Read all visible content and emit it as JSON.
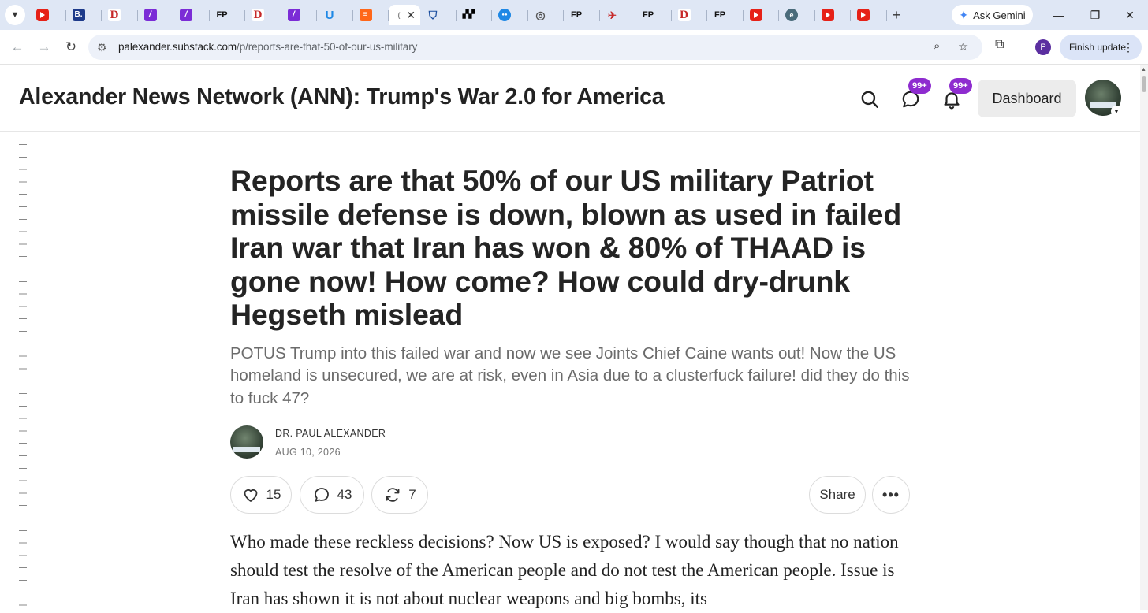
{
  "browser": {
    "tabs": [
      {
        "icon": "youtube-icon",
        "kind": "yt",
        "glyph": ""
      },
      {
        "icon": "b-favicon",
        "kind": "b",
        "glyph": "B."
      },
      {
        "icon": "d-favicon",
        "kind": "d",
        "glyph": "D"
      },
      {
        "icon": "substack-favicon",
        "kind": "s",
        "glyph": "/"
      },
      {
        "icon": "substack-favicon",
        "kind": "s",
        "glyph": "/"
      },
      {
        "icon": "fp-favicon",
        "kind": "fp",
        "glyph": "FP"
      },
      {
        "icon": "d-favicon",
        "kind": "d",
        "glyph": "D"
      },
      {
        "icon": "substack-favicon",
        "kind": "s",
        "glyph": "/"
      },
      {
        "icon": "t-favicon",
        "kind": "t",
        "glyph": "U"
      },
      {
        "icon": "bookmark-favicon",
        "kind": "ss",
        "glyph": "≡"
      },
      {
        "icon": "substack-favicon",
        "kind": "active",
        "glyph": ""
      },
      {
        "icon": "shield-favicon",
        "kind": "sh",
        "glyph": "⛉"
      },
      {
        "icon": "bird-favicon",
        "kind": "bl",
        "glyph": "▞▞"
      },
      {
        "icon": "circle-favicon",
        "kind": "cd",
        "glyph": "●●"
      },
      {
        "icon": "globe-icon",
        "kind": "gl",
        "glyph": "◎"
      },
      {
        "icon": "fp-favicon",
        "kind": "fp",
        "glyph": "FP"
      },
      {
        "icon": "plane-favicon",
        "kind": "pl",
        "glyph": "✈"
      },
      {
        "icon": "fp-favicon",
        "kind": "fp",
        "glyph": "FP"
      },
      {
        "icon": "d-favicon",
        "kind": "d",
        "glyph": "D"
      },
      {
        "icon": "fp-favicon",
        "kind": "fp",
        "glyph": "FP"
      },
      {
        "icon": "youtube-icon",
        "kind": "yt",
        "glyph": ""
      },
      {
        "icon": "epoch-favicon",
        "kind": "en",
        "glyph": "e"
      },
      {
        "icon": "youtube-icon",
        "kind": "yt",
        "glyph": ""
      },
      {
        "icon": "youtube-icon",
        "kind": "yt",
        "glyph": ""
      }
    ],
    "gemini_label": "Ask Gemini",
    "url_host": "palexander.substack.com",
    "url_path": "/p/reports-are-that-50-of-our-us-military",
    "profile_initial": "P",
    "finish_update_label": "Finish update"
  },
  "header": {
    "publication_title": "Alexander News Network (ANN): Trump's War 2.0 for America",
    "chat_badge": "99+",
    "notification_badge": "99+",
    "dashboard_label": "Dashboard"
  },
  "article": {
    "headline": "Reports are that 50% of our US military Patriot missile defense is down, blown as used in failed Iran war that Iran has won & 80% of THAAD is gone now! How come? How could dry-drunk Hegseth mislead",
    "subtitle": "POTUS Trump into this failed war and now we see Joints Chief Caine wants out! Now the US homeland is unsecured, we are at risk, even in Asia due to a clusterfuck failure! did they do this to fuck 47?",
    "author": "DR. PAUL ALEXANDER",
    "date": "AUG 10, 2026",
    "likes": "15",
    "comments": "43",
    "restacks": "7",
    "share_label": "Share",
    "more_label": "•••",
    "body": "Who made these reckless decisions? Now US is exposed? I would say though that no nation should test the resolve of the American people and do not test the American people. Issue is Iran has shown it is not about nuclear weapons and big bombs, its"
  }
}
